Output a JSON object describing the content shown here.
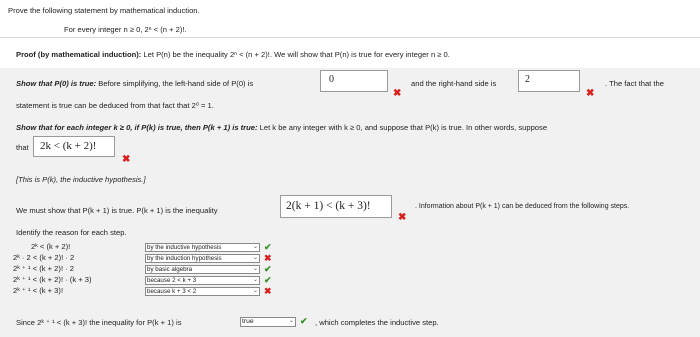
{
  "header": {
    "instruction": "Prove the following statement by mathematical induction.",
    "statement": "For every integer n ≥ 0, 2ⁿ < (n + 2)!."
  },
  "proof_intro": {
    "bold": "Proof (by mathematical induction):",
    "rest": " Let P(n) be the inequality 2ⁿ < (n + 2)!. We will show that P(n) is true for every integer n ≥ 0."
  },
  "base_case": {
    "bold": "Show that P(0) is true:",
    "rest": " Before simplifying, the left-hand side of P(0) is",
    "lhs_value": "0",
    "middle": "and the right-hand side is",
    "rhs_value": "2",
    "trail": ". The fact that the",
    "line2": "statement is true can be deduced from that fact that 2⁰ = 1."
  },
  "inductive": {
    "bold": "Show that for each integer k ≥ 0, if P(k) is true, then P(k + 1) is true:",
    "rest": " Let k be any integer with k ≥ 0, and suppose that P(k) is true. In other words, suppose",
    "that_label": "that",
    "that_value": "2k < (k + 2)!",
    "hypothesis_note": "[This is P(k), the inductive hypothesis.]",
    "must_show": "We must show that P(k + 1) is true. P(k + 1) is the inequality",
    "must_value": "2(k + 1) < (k + 3)!",
    "info": ". Information about P(k + 1) can be deduced from the following steps.",
    "identify": "Identify the reason for each step.",
    "steps": [
      {
        "expr": "2ᵏ < (k + 2)!",
        "reason": "by the inductive hypothesis",
        "mark": "✔"
      },
      {
        "expr": "2ᵏ · 2 < (k + 2)! · 2",
        "reason": "by the induction hypothesis",
        "mark": "✖"
      },
      {
        "expr": "2ᵏ ⁺ ¹ < (k + 2)! · 2",
        "reason": "by basic algebra",
        "mark": "✔"
      },
      {
        "expr": "2ᵏ ⁺ ¹ < (k + 2)! · (k + 3)",
        "reason": "because 2 < k + 3",
        "mark": "✔"
      },
      {
        "expr": "2ᵏ ⁺ ¹ < (k + 3)!",
        "reason": "because k + 3 < 2",
        "mark": "✖"
      }
    ],
    "since_pre": "Since 2ᵏ ⁺ ¹ < (k + 3)! the inequality for P(k + 1) is",
    "since_value": "true",
    "since_post": ", which completes the inductive step."
  },
  "marks": {
    "wrong": "✖",
    "right": "✔",
    "dropdown_arrow": "⌄"
  },
  "colors": {
    "wrong": "#d9201c",
    "right": "#3a8f2a",
    "panel_bg": "#f1f1f1"
  }
}
